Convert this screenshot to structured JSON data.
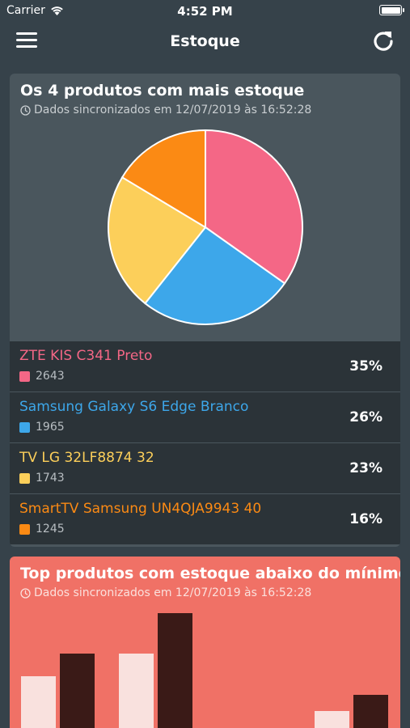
{
  "status_bar": {
    "carrier": "Carrier",
    "time": "4:52 PM"
  },
  "navbar": {
    "title": "Estoque",
    "menu_icon": "hamburger-menu-icon",
    "refresh_icon": "refresh-icon"
  },
  "stock_card": {
    "title": "Os 4 produtos com mais estoque",
    "sync_text": "Dados sincronizados em 12/07/2019 às 16:52:28",
    "background": "#4a565d",
    "chart_data": {
      "type": "pie",
      "categories": [
        "ZTE KIS C341 Preto",
        "Samsung Galaxy S6 Edge Branco",
        "TV LG 32LF8874 32",
        "SmartTV Samsung UN4QJA9943 40"
      ],
      "values": [
        2643,
        1965,
        1743,
        1245
      ],
      "colors": [
        "#f46786",
        "#3da7ea",
        "#fccf5a",
        "#fb8a14"
      ]
    },
    "items": [
      {
        "name": "ZTE KIS C341 Preto",
        "qty": "2643",
        "pct": "35%",
        "color": "#f46786"
      },
      {
        "name": "Samsung Galaxy S6 Edge Branco",
        "qty": "1965",
        "pct": "26%",
        "color": "#3da7ea"
      },
      {
        "name": "TV LG 32LF8874 32",
        "qty": "1743",
        "pct": "23%",
        "color": "#fccf5a"
      },
      {
        "name": "SmartTV Samsung UN4QJA9943 40",
        "qty": "1245",
        "pct": "16%",
        "color": "#fb8a14"
      }
    ]
  },
  "min_card": {
    "title": "Top produtos com estoque abaixo do mínimo",
    "sync_text": "Dados sincronizados em 12/07/2019 às 16:52:28",
    "background": "#f07166",
    "chart_data": {
      "type": "bar",
      "series": [
        {
          "values": [
            64,
            92,
            0,
            0,
            21
          ],
          "color": "#f9e1de"
        },
        {
          "values": [
            92,
            142,
            0,
            0,
            41
          ],
          "color": "#3a1a17"
        }
      ]
    }
  }
}
